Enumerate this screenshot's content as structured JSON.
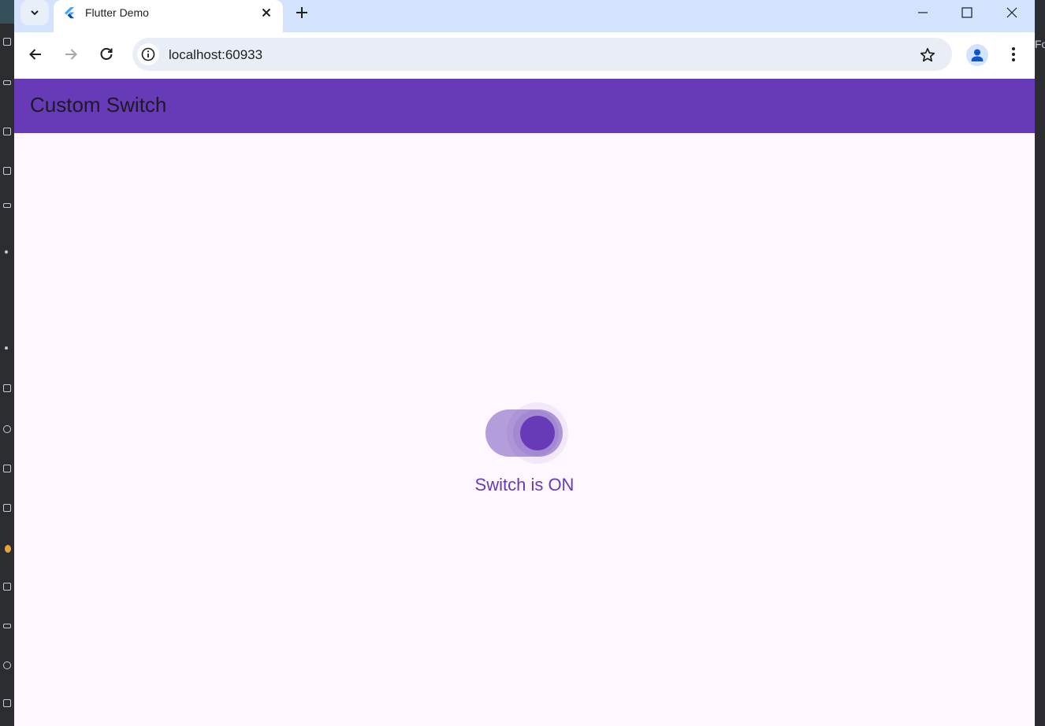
{
  "browser": {
    "tab": {
      "title": "Flutter Demo",
      "favicon": "flutter-logo-icon"
    },
    "address": {
      "url": "localhost:60933"
    },
    "icons": {
      "tab_search": "chevron-down-icon",
      "tab_close": "close-icon",
      "new_tab": "plus-icon",
      "back": "arrow-left-icon",
      "forward": "arrow-right-icon",
      "reload": "reload-icon",
      "site_info": "info-icon",
      "bookmark": "star-icon",
      "profile": "person-icon",
      "menu": "more-vert-icon",
      "minimize": "minimize-icon",
      "maximize": "maximize-icon",
      "close_window": "close-icon"
    }
  },
  "app": {
    "appbar": {
      "title": "Custom Switch"
    },
    "switch": {
      "state": "on",
      "status_text": "Switch is ON"
    },
    "colors": {
      "primary": "#673ab7",
      "track": "#b39ddb",
      "background": "#fef7ff"
    }
  },
  "background_ide": {
    "right_edge_text": "Fo"
  }
}
